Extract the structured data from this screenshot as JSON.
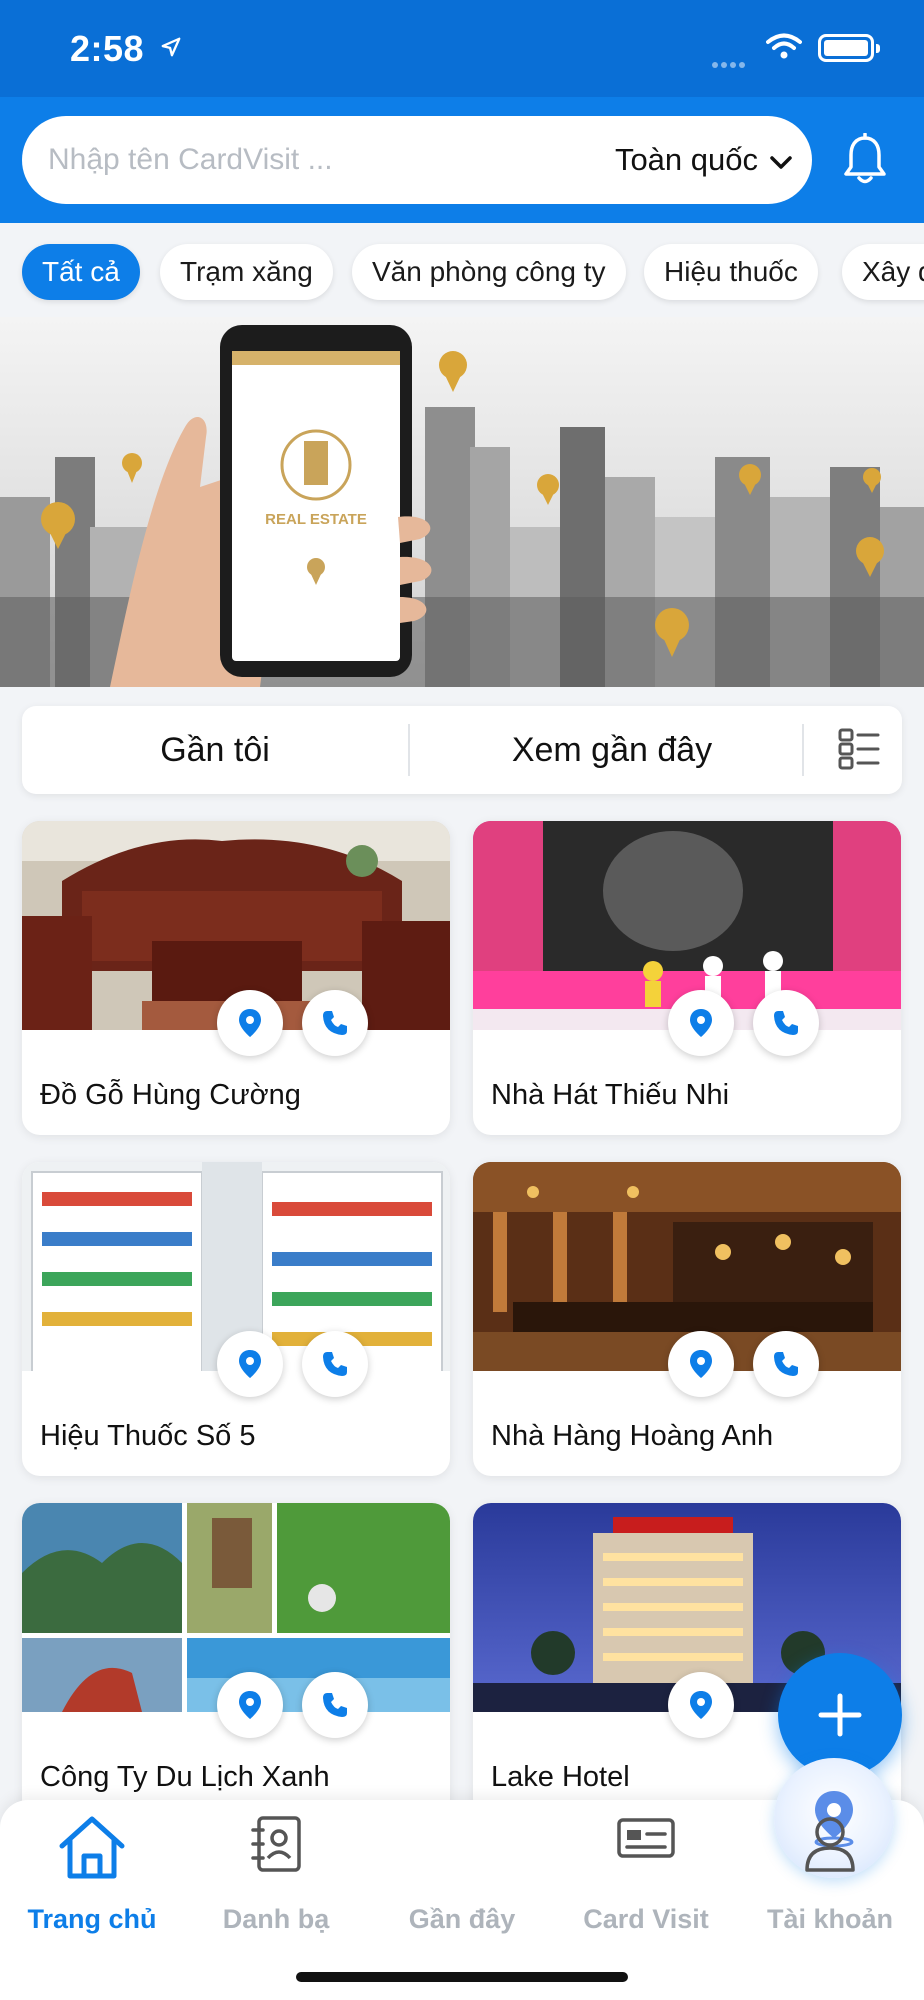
{
  "status_bar": {
    "time": "2:58"
  },
  "search": {
    "placeholder": "Nhập tên CardVisit ...",
    "region": "Toàn quốc"
  },
  "categories": [
    {
      "label": "Tất cả",
      "active": true
    },
    {
      "label": "Trạm xăng",
      "active": false
    },
    {
      "label": "Văn phòng công ty",
      "active": false
    },
    {
      "label": "Hiệu thuốc",
      "active": false
    },
    {
      "label": "Xây dựng",
      "active": false
    }
  ],
  "banner": {
    "phone_brand": "REAL ESTATE"
  },
  "tabs": {
    "near_me": "Gần tôi",
    "recently_viewed": "Xem gần đây"
  },
  "cards": [
    {
      "name": "Đồ Gỗ Hùng Cường",
      "image": "wooden-furniture"
    },
    {
      "name": "Nhà Hát Thiếu Nhi",
      "image": "children-theater-stage"
    },
    {
      "name": "Hiệu Thuốc Số 5",
      "image": "pharmacy-shelves"
    },
    {
      "name": "Nhà Hàng Hoàng Anh",
      "image": "restaurant-interior"
    },
    {
      "name": "Công Ty Du Lịch Xanh",
      "image": "travel-collage"
    },
    {
      "name": "Lake Hotel",
      "image": "hotel-night"
    }
  ],
  "bottom_nav": [
    {
      "label": "Trang chủ",
      "icon": "home-icon",
      "active": true
    },
    {
      "label": "Danh bạ",
      "icon": "contacts-icon",
      "active": false
    },
    {
      "label": "Gần đây",
      "icon": "location-pin-icon",
      "active": false
    },
    {
      "label": "Card Visit",
      "icon": "card-icon",
      "active": false
    },
    {
      "label": "Tài khoản",
      "icon": "user-icon",
      "active": false
    }
  ],
  "colors": {
    "primary": "#0d7ee8",
    "status_bar": "#0a6fd6",
    "inactive_nav": "#aeb4bb"
  }
}
